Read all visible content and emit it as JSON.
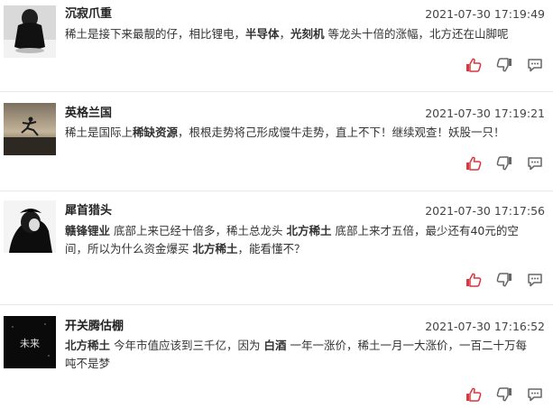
{
  "comments": [
    {
      "user": "沉寂爪重",
      "time": "2021-07-30 17:19:49",
      "avatar": "person-dark-avatar",
      "segments": [
        {
          "t": "稀土是接下来最靓的仔，相比锂电，",
          "k": false
        },
        {
          "t": "半导体",
          "k": true
        },
        {
          "t": "，",
          "k": false
        },
        {
          "t": "光刻机",
          "k": true
        },
        {
          "t": " 等龙头十倍的涨幅，北方还在山脚呢",
          "k": false
        }
      ]
    },
    {
      "user": "英格兰国",
      "time": "2021-07-30 17:19:21",
      "avatar": "runner-sunset-avatar",
      "segments": [
        {
          "t": "稀土是国际上",
          "k": false
        },
        {
          "t": "稀缺资源",
          "k": true
        },
        {
          "t": "，根根走势将己形成慢牛走势，直上不下！继续观查！妖股一只！",
          "k": false
        }
      ]
    },
    {
      "user": "犀首猎头",
      "time": "2021-07-30 17:17:56",
      "avatar": "bw-portrait-avatar",
      "segments": [
        {
          "t": "赣锋锂业",
          "k": true
        },
        {
          "t": " 底部上来已经十倍多，稀土总龙头 ",
          "k": false
        },
        {
          "t": "北方稀土",
          "k": true
        },
        {
          "t": " 底部上来才五倍，最少还有40元的空间，所以为什么资金爆买 ",
          "k": false
        },
        {
          "t": "北方稀土",
          "k": true
        },
        {
          "t": "，能看懂不？",
          "k": false
        }
      ]
    },
    {
      "user": "开关腾估棚",
      "time": "2021-07-30 17:16:52",
      "avatar": "weilai-text-avatar",
      "avatar_text": "未来",
      "segments": [
        {
          "t": "北方稀土",
          "k": true
        },
        {
          "t": " 今年市值应该到三千亿，因为 ",
          "k": false
        },
        {
          "t": "白酒",
          "k": true
        },
        {
          "t": " 一年一涨价，稀土一月一大涨价，一百二十万每吨不是梦",
          "k": false
        }
      ]
    }
  ],
  "icons": {
    "like": "thumbs-up-icon",
    "dislike": "thumbs-down-icon",
    "reply": "comment-icon",
    "accent": "#d9363e",
    "muted": "#666666"
  }
}
